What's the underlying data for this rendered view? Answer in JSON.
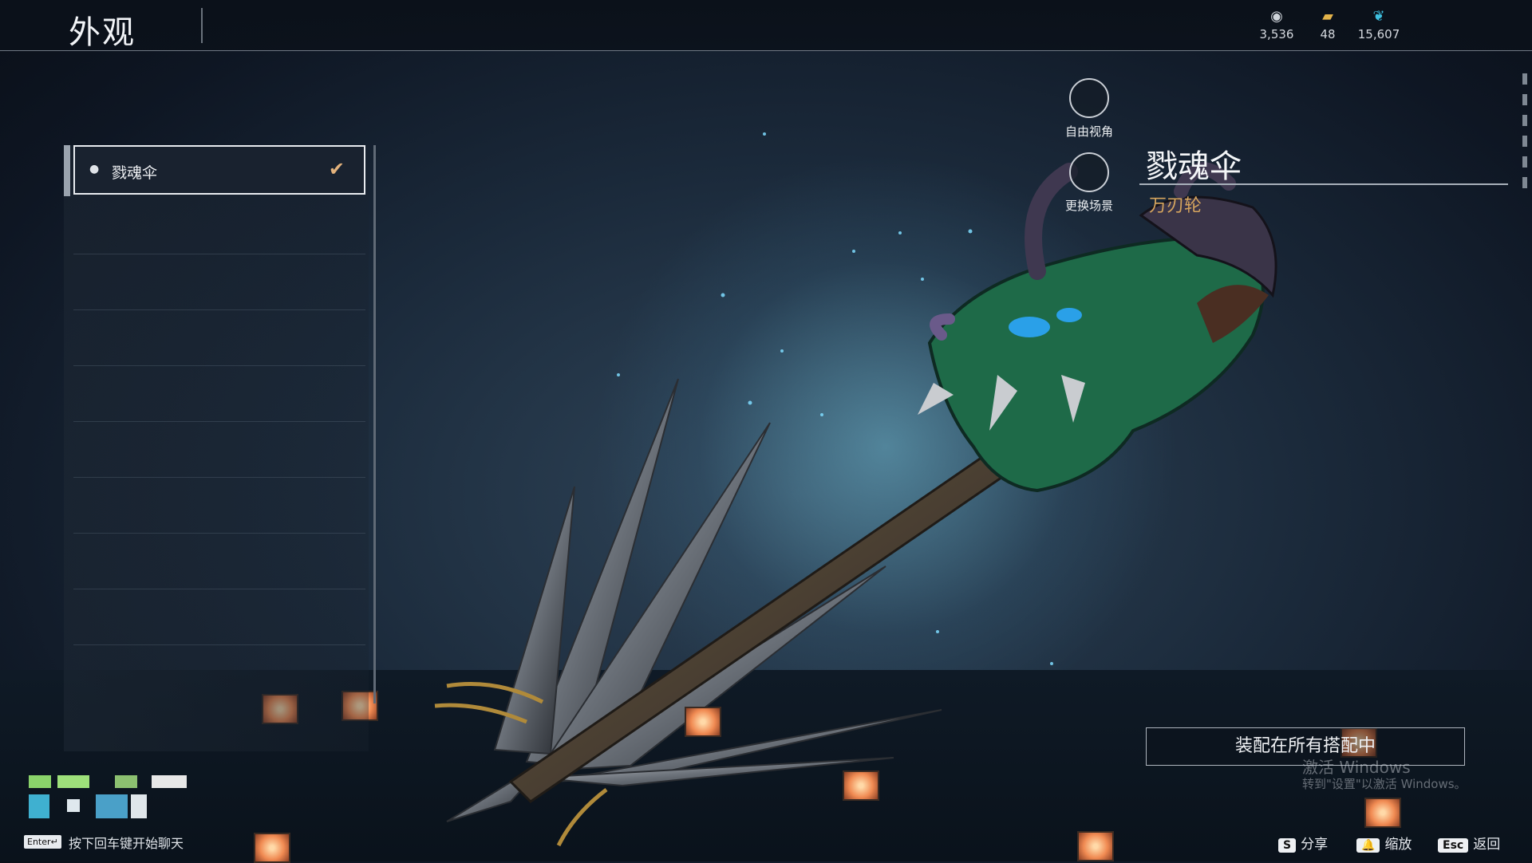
{
  "header": {
    "title": "外观",
    "currencies": [
      {
        "icon": "coin-icon",
        "value": "3,536"
      },
      {
        "icon": "ticket-icon",
        "value": "48"
      },
      {
        "icon": "feather-icon",
        "value": "15,607"
      }
    ]
  },
  "skin_list": {
    "items": [
      {
        "label": "戮魂伞",
        "selected": true
      }
    ]
  },
  "view_buttons": {
    "free_view": "自由视角",
    "change_scene": "更换场景"
  },
  "item_info": {
    "name": "戮魂伞",
    "weapon_type": "万刃轮"
  },
  "equip_button": "装配在所有搭配中",
  "watermark": {
    "line1": "激活 Windows",
    "line2": "转到\"设置\"以激活 Windows。"
  },
  "footer": {
    "enter_key": "Enter↵",
    "chat_hint": "按下回车键开始聊天",
    "actions": [
      {
        "key": "S",
        "label": "分享"
      },
      {
        "key": "🔔",
        "label": "缩放"
      },
      {
        "key": "Esc",
        "label": "返回"
      }
    ]
  },
  "colors": {
    "accent_gold": "#d6a55e",
    "check_orange": "#e2b27c"
  }
}
